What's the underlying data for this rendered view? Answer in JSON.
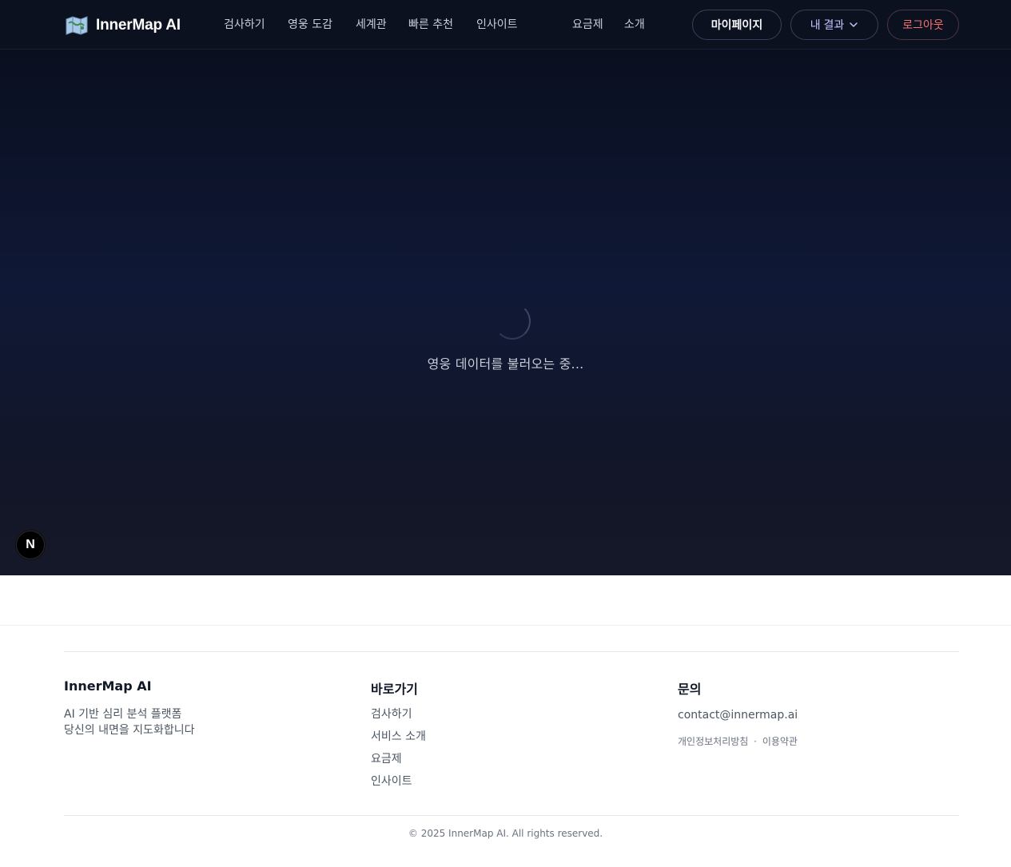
{
  "header": {
    "logo_text": "InnerMap AI",
    "logo_icon": "map-icon",
    "nav": [
      {
        "label": "검사하기"
      },
      {
        "label": "영웅 도감"
      },
      {
        "label": "세계관"
      },
      {
        "label": "빠른 추천"
      },
      {
        "label": "인사이트"
      },
      {
        "label": "요금제"
      },
      {
        "label": "소개"
      }
    ],
    "mypage_label": "마이페이지",
    "results_label": "내 결과",
    "logout_label": "로그아웃"
  },
  "main": {
    "loading_text": "영웅 데이터를 불러오는 중...",
    "dev_badge_label": "N"
  },
  "footer": {
    "brand": {
      "title": "InnerMap AI",
      "line1": "AI 기반 심리 분석 플랫폼",
      "line2": "당신의 내면을 지도화합니다"
    },
    "links": {
      "title": "바로가기",
      "items": [
        "검사하기",
        "서비스 소개",
        "요금제",
        "인사이트"
      ]
    },
    "contact": {
      "title": "문의",
      "email": "contact@innermap.ai",
      "privacy": "개인정보처리방침",
      "separator": "·",
      "terms": "이용약관"
    },
    "copyright": "© 2025 InnerMap AI. All rights reserved."
  },
  "colors": {
    "header_bg": "#0c1120",
    "accent_purple": "#c7c4ff",
    "logout_red": "#f87171"
  }
}
